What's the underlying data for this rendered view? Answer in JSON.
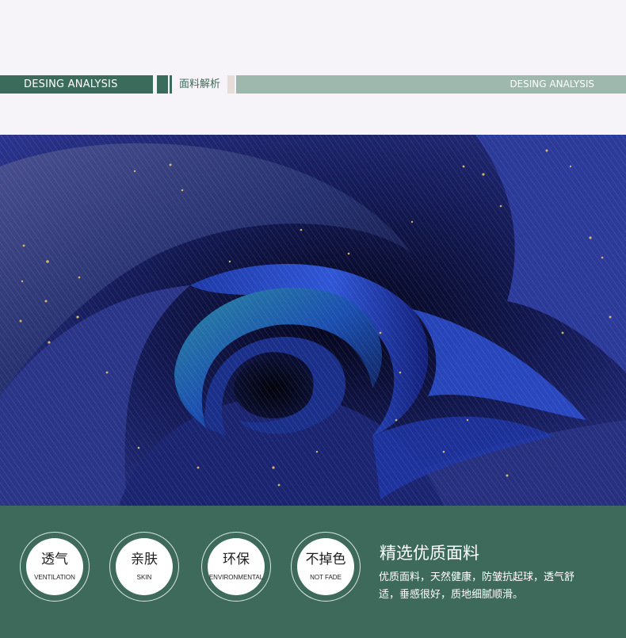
{
  "header": {
    "left_label": "DESING ANALYSIS",
    "center_label": "面料解析",
    "right_label": "DESING ANALYSIS"
  },
  "fabric_image": {
    "subject": "fabric-swirl-photo",
    "colors": {
      "deep_navy": "#0a0d28",
      "royal_blue": "#1e3db0",
      "teal": "#2a8aa0",
      "sparkle_gold": "#d6b56a"
    }
  },
  "features": [
    {
      "cn": "透气",
      "en": "VENTILATION"
    },
    {
      "cn": "亲肤",
      "en": "SKIN"
    },
    {
      "cn": "环保",
      "en": "ENVIRONMENTAL"
    },
    {
      "cn": "不掉色",
      "en": "NOT FADE"
    }
  ],
  "panel": {
    "title": "精选优质面料",
    "description": "优质面料，天然健康，防皱抗起球，透气舒适，垂感很好，质地细腻顺滑。"
  },
  "colors": {
    "primary_green": "#3b6b5a",
    "light_green": "#9fb8ad",
    "background": "#f6f4f8"
  }
}
